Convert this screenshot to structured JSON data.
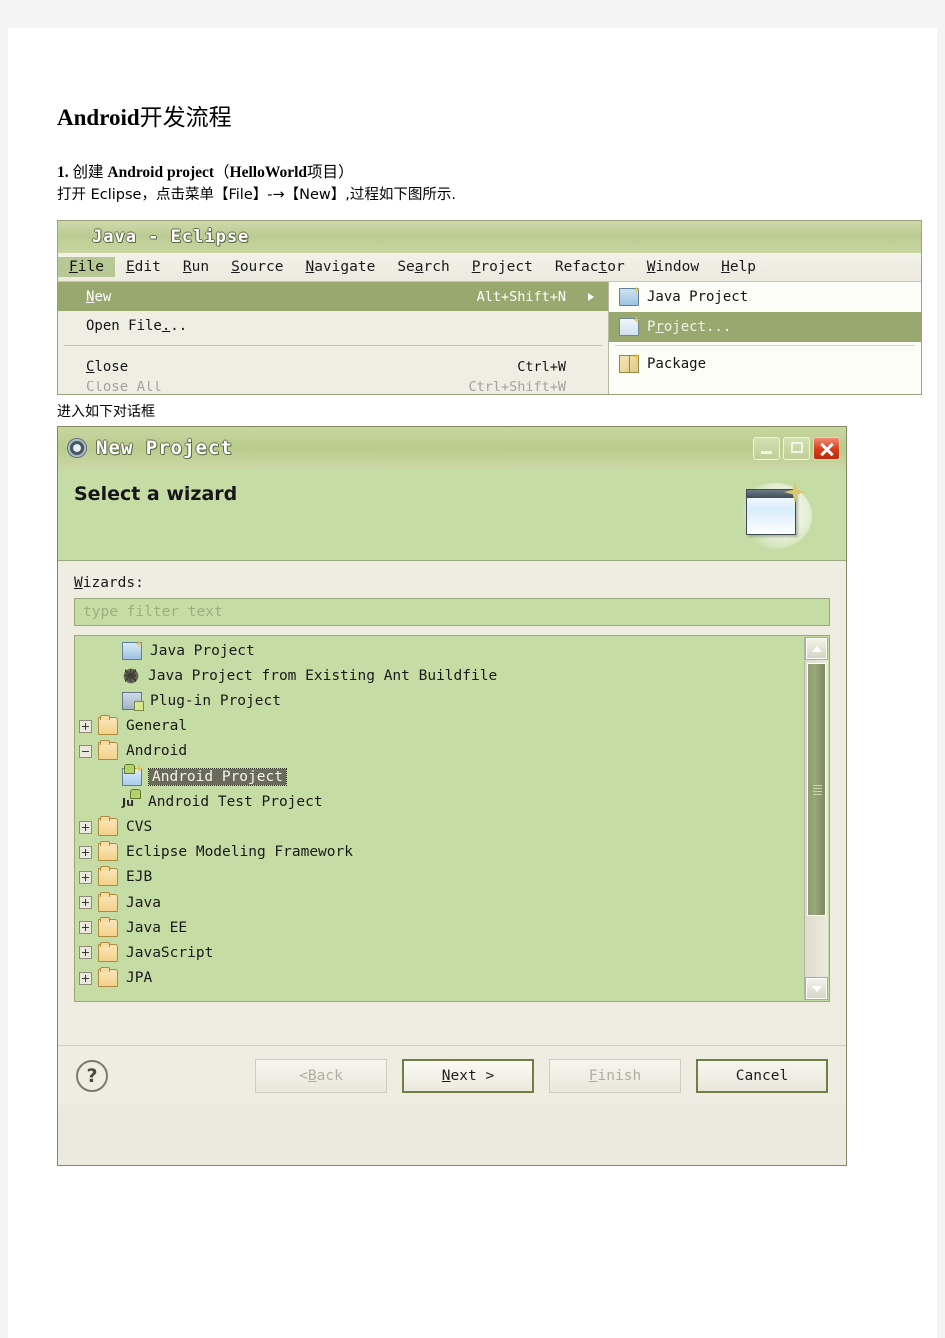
{
  "document": {
    "title_bold": "Android",
    "title_cjk": "开发流程",
    "step_num": "1.",
    "step_cjk_1": "创建",
    "step_bold_1": "Android project",
    "step_paren_open": "（",
    "step_bold_2": "HelloWorld",
    "step_cjk_2": "项目",
    "step_paren_close": "）",
    "instruction": "打开 Eclipse，点击菜单【File】-→【New】,过程如下图所示.",
    "caption_dialog": "进入如下对话框"
  },
  "eclipse_window": {
    "title": "Java - Eclipse",
    "title_icon": "eclipse-gear-icon",
    "menubar": [
      {
        "label": "File",
        "active": true
      },
      {
        "label": "Edit",
        "active": false
      },
      {
        "label": "Run",
        "active": false
      },
      {
        "label": "Source",
        "active": false
      },
      {
        "label": "Navigate",
        "active": false
      },
      {
        "label": "Search",
        "active": false
      },
      {
        "label": "Project",
        "active": false
      },
      {
        "label": "Refactor",
        "active": false
      },
      {
        "label": "Window",
        "active": false
      },
      {
        "label": "Help",
        "active": false
      }
    ],
    "file_menu": {
      "items": [
        {
          "label": "New",
          "accel": "Alt+Shift+N",
          "submenu": true,
          "highlighted": true
        },
        {
          "label": "Open File...",
          "accel": "",
          "submenu": false,
          "highlighted": false
        },
        {
          "label": "Close",
          "accel": "Ctrl+W",
          "submenu": false,
          "highlighted": false
        },
        {
          "label": "Close All",
          "accel": "Ctrl+Shift+W",
          "submenu": false,
          "highlighted": false
        }
      ]
    },
    "new_submenu": {
      "items": [
        {
          "label": "Java Project",
          "icon": "java-project-icon",
          "highlighted": false
        },
        {
          "label": "Project...",
          "icon": "project-icon",
          "highlighted": true
        },
        {
          "label": "Package",
          "icon": "package-icon",
          "highlighted": false
        }
      ]
    }
  },
  "new_project_dialog": {
    "window_title": "New Project",
    "title_icon": "eclipse-gear-icon",
    "window_buttons": {
      "minimize": "minimize-icon",
      "maximize": "maximize-icon",
      "close": "close-icon"
    },
    "banner_title": "Select a wizard",
    "banner_image": "wizard-window-sparkle-icon",
    "wizards_label": "Wizards:",
    "filter_placeholder": "type filter text",
    "filter_value": "",
    "tree": [
      {
        "label": "Java Project",
        "icon": "java-project-icon",
        "indent": 1,
        "expander": "none",
        "selected": false
      },
      {
        "label": "Java Project from Existing Ant Buildfile",
        "icon": "ant-buildfile-icon",
        "indent": 1,
        "expander": "none",
        "selected": false
      },
      {
        "label": "Plug-in Project",
        "icon": "plugin-project-icon",
        "indent": 1,
        "expander": "none",
        "selected": false
      },
      {
        "label": "General",
        "icon": "folder-icon",
        "indent": 0,
        "expander": "plus",
        "selected": false
      },
      {
        "label": "Android",
        "icon": "folder-icon",
        "indent": 0,
        "expander": "minus",
        "selected": false
      },
      {
        "label": "Android Project",
        "icon": "android-project-icon",
        "indent": 2,
        "expander": "none",
        "selected": true
      },
      {
        "label": "Android Test Project",
        "icon": "android-test-project-icon",
        "indent": 2,
        "expander": "none",
        "selected": false
      },
      {
        "label": "CVS",
        "icon": "folder-icon",
        "indent": 0,
        "expander": "plus",
        "selected": false
      },
      {
        "label": "Eclipse Modeling Framework",
        "icon": "folder-icon",
        "indent": 0,
        "expander": "plus",
        "selected": false
      },
      {
        "label": "EJB",
        "icon": "folder-icon",
        "indent": 0,
        "expander": "plus",
        "selected": false
      },
      {
        "label": "Java",
        "icon": "folder-icon",
        "indent": 0,
        "expander": "plus",
        "selected": false
      },
      {
        "label": "Java EE",
        "icon": "folder-icon",
        "indent": 0,
        "expander": "plus",
        "selected": false
      },
      {
        "label": "JavaScript",
        "icon": "folder-icon",
        "indent": 0,
        "expander": "plus",
        "selected": false
      },
      {
        "label": "JPA",
        "icon": "folder-icon",
        "indent": 0,
        "expander": "plus",
        "selected": false
      }
    ],
    "scrollbar": {
      "up_icon": "chevron-up-icon",
      "down_icon": "chevron-down-icon"
    },
    "buttons": {
      "help": "?",
      "back": "< Back",
      "next": "Next >",
      "finish": "Finish",
      "cancel": "Cancel"
    }
  },
  "colors": {
    "titlebar_green": "#bccb92",
    "menu_highlight": "#99a86e",
    "banner_green": "#c5dda5",
    "dialog_bg": "#efede1",
    "selection_gray": "#6b6b5c",
    "close_red": "#d63b18",
    "default_button_border": "#6f8046"
  }
}
